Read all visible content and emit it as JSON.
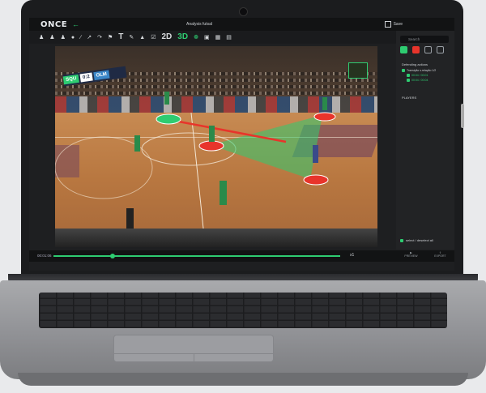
{
  "app": {
    "logo": "ONCE",
    "title": "Analysis futsal",
    "save_label": "Save"
  },
  "toolbar": {
    "label_2d": "2D",
    "label_3d": "3D",
    "label_t": "T"
  },
  "video": {
    "score": {
      "home": "SQU",
      "result": "0:2",
      "away": "OLM"
    }
  },
  "timeline": {
    "start_time": "00:01:06",
    "speed": "x1"
  },
  "panel": {
    "search_placeholder": "Search",
    "actions_header": "Defending actions",
    "action_items": [
      {
        "label": "Transição s.relação 1/2",
        "tag1": "",
        "tag2": ""
      },
      {
        "label": "00:04 / 00:01",
        "tag": ""
      },
      {
        "label": "00:04 / 00:04",
        "tag": ""
      }
    ],
    "players_header": "PLAYERS",
    "select_all": "select / deselect all",
    "btn_preview": "PREVIEW",
    "btn_export": "EXPORT"
  },
  "colors": {
    "accent": "#2ecc71",
    "marker_red": "#e8342b"
  }
}
